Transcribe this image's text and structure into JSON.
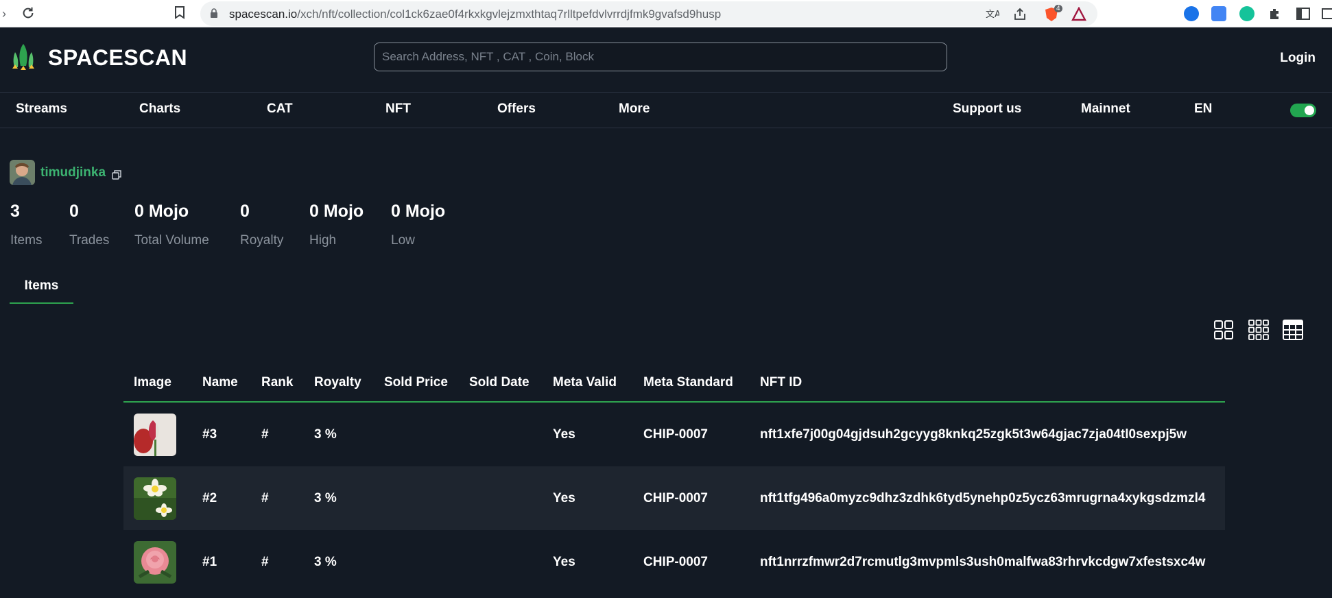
{
  "browser": {
    "url_host": "spacescan.io",
    "url_path": "/xch/nft/collection/col1ck6zae0f4rkxkgvlejzmxthtaq7rlltpefdvlvrrdjfmk9gvafsd9husp",
    "brave_badge": "4"
  },
  "header": {
    "brand": "SPACESCAN",
    "search_placeholder": "Search Address, NFT , CAT , Coin, Block",
    "login_label": "Login"
  },
  "nav": {
    "items": [
      "Streams",
      "Charts",
      "CAT",
      "NFT",
      "Offers",
      "More"
    ],
    "right": [
      "Support us",
      "Mainnet",
      "EN"
    ],
    "theme_toggle_on": true
  },
  "collection": {
    "owner": "timudjinka",
    "stats": [
      {
        "value": "3",
        "label": "Items"
      },
      {
        "value": "0",
        "label": "Trades"
      },
      {
        "value": "0 Mojo",
        "label": "Total Volume"
      },
      {
        "value": "0",
        "label": "Royalty"
      },
      {
        "value": "0 Mojo",
        "label": "High"
      },
      {
        "value": "0 Mojo",
        "label": "Low"
      }
    ]
  },
  "tabs": {
    "active": "Items"
  },
  "view_modes": [
    "grid-large-icon",
    "grid-small-icon",
    "table-view-icon"
  ],
  "table": {
    "columns": [
      "Image",
      "Name",
      "Rank",
      "Royalty",
      "Sold Price",
      "Sold Date",
      "Meta Valid",
      "Meta Standard",
      "NFT ID"
    ],
    "rows": [
      {
        "image": "tulip",
        "name": "#3",
        "rank": "#",
        "royalty": "3 %",
        "sold_price": "",
        "sold_date": "",
        "meta_valid": "Yes",
        "meta_standard": "CHIP-0007",
        "nft_id": "nft1xfe7j00g04gjdsuh2gcyyg8knkq25zgk5t3w64gjac7zja04tl0sexpj5w"
      },
      {
        "image": "daisy",
        "name": "#2",
        "rank": "#",
        "royalty": "3 %",
        "sold_price": "",
        "sold_date": "",
        "meta_valid": "Yes",
        "meta_standard": "CHIP-0007",
        "nft_id": "nft1tfg496a0myzc9dhz3zdhk6tyd5ynehp0z5ycz63mrugrna4xykgsdzmzl4"
      },
      {
        "image": "rose",
        "name": "#1",
        "rank": "#",
        "royalty": "3 %",
        "sold_price": "",
        "sold_date": "",
        "meta_valid": "Yes",
        "meta_standard": "CHIP-0007",
        "nft_id": "nft1nrrzfmwr2d7rcmutlg3mvpmls3ush0malfwa83rhrvkcdgw7xfestsxc4w"
      }
    ]
  },
  "colors": {
    "accent_green": "#2ea44f",
    "background": "#131a24",
    "toggle_green": "#22a650"
  }
}
